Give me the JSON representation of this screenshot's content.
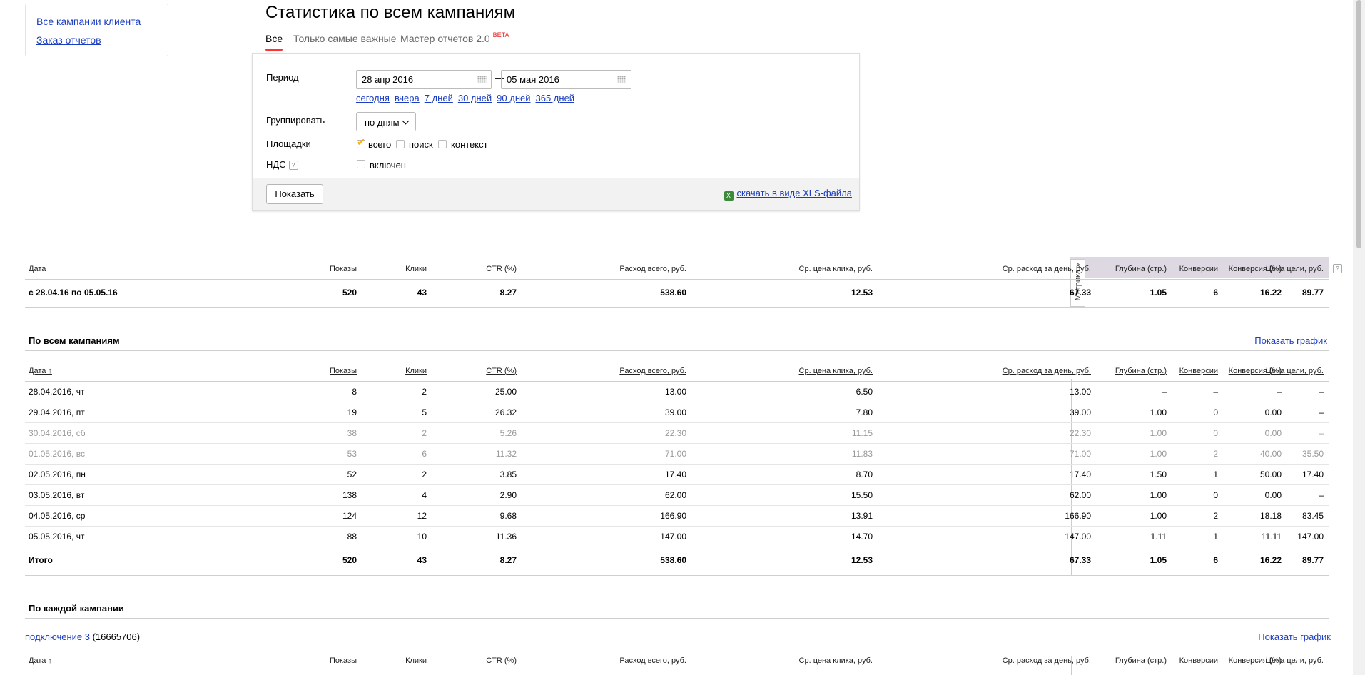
{
  "sidebar": {
    "links": [
      "Все кампании клиента",
      "Заказ отчетов"
    ]
  },
  "page_title": "Статистика по всем кампаниям",
  "tabs": {
    "all": "Все",
    "important": "Только самые важные",
    "master": "Мастер отчетов 2.0",
    "beta": "BETA"
  },
  "filters": {
    "period_label": "Период",
    "date_from": "28 апр 2016",
    "date_to": "05 мая 2016",
    "dash": "—",
    "quick": [
      "сегодня",
      "вчера",
      "7 дней",
      "30 дней",
      "90 дней",
      "365 дней"
    ],
    "group_label": "Группировать",
    "group_value": "по дням",
    "platforms_label": "Площадки",
    "platforms": [
      "всего",
      "поиск",
      "контекст"
    ],
    "vat_label": "НДС",
    "vat_help": "?",
    "vat_option": "включен",
    "show_button": "Показать",
    "xls_link": "скачать в виде XLS-файла"
  },
  "columns": [
    "Дата",
    "Показы",
    "Клики",
    "CTR (%)",
    "Расход всего, руб.",
    "Ср. цена клика, руб.",
    "Ср. расход за день, руб.",
    "Глубина (стр.)",
    "Конверсии",
    "Конверсия (%)",
    "Цена цели, руб."
  ],
  "columns_sorted": [
    "Дата ↑",
    "Показы",
    "Клики",
    "CTR (%)",
    "Расход всего, руб.",
    "Ср. цена клика, руб.",
    "Ср. расход за день, руб.",
    "Глубина (стр.)",
    "Конверсии",
    "Конверсия (%)",
    "Цена цели, руб."
  ],
  "metrika_tab": "Метрика »",
  "help_mark": "?",
  "summary": [
    "с 28.04.16 по 05.05.16",
    "520",
    "43",
    "8.27",
    "538.60",
    "12.53",
    "67.33",
    "1.05",
    "6",
    "16.22",
    "89.77"
  ],
  "section_all": "По всем кампаниям",
  "show_graph": "Показать график",
  "daily_rows": [
    {
      "grey": false,
      "cells": [
        "28.04.2016, чт",
        "8",
        "2",
        "25.00",
        "13.00",
        "6.50",
        "13.00",
        "–",
        "–",
        "–",
        "–"
      ]
    },
    {
      "grey": false,
      "cells": [
        "29.04.2016, пт",
        "19",
        "5",
        "26.32",
        "39.00",
        "7.80",
        "39.00",
        "1.00",
        "0",
        "0.00",
        "–"
      ]
    },
    {
      "grey": true,
      "cells": [
        "30.04.2016, сб",
        "38",
        "2",
        "5.26",
        "22.30",
        "11.15",
        "22.30",
        "1.00",
        "0",
        "0.00",
        "–"
      ]
    },
    {
      "grey": true,
      "cells": [
        "01.05.2016, вс",
        "53",
        "6",
        "11.32",
        "71.00",
        "11.83",
        "71.00",
        "1.00",
        "2",
        "40.00",
        "35.50"
      ]
    },
    {
      "grey": false,
      "cells": [
        "02.05.2016, пн",
        "52",
        "2",
        "3.85",
        "17.40",
        "8.70",
        "17.40",
        "1.50",
        "1",
        "50.00",
        "17.40"
      ]
    },
    {
      "grey": false,
      "cells": [
        "03.05.2016, вт",
        "138",
        "4",
        "2.90",
        "62.00",
        "15.50",
        "62.00",
        "1.00",
        "0",
        "0.00",
        "–"
      ]
    },
    {
      "grey": false,
      "cells": [
        "04.05.2016, ср",
        "124",
        "12",
        "9.68",
        "166.90",
        "13.91",
        "166.90",
        "1.00",
        "2",
        "18.18",
        "83.45"
      ]
    },
    {
      "grey": false,
      "cells": [
        "05.05.2016, чт",
        "88",
        "10",
        "11.36",
        "147.00",
        "14.70",
        "147.00",
        "1.11",
        "1",
        "11.11",
        "147.00"
      ]
    }
  ],
  "total_row": [
    "Итого",
    "520",
    "43",
    "8.27",
    "538.60",
    "12.53",
    "67.33",
    "1.05",
    "6",
    "16.22",
    "89.77"
  ],
  "section_each": "По каждой кампании",
  "campaign": {
    "name": "подключение 3",
    "id": "(16665706)"
  }
}
